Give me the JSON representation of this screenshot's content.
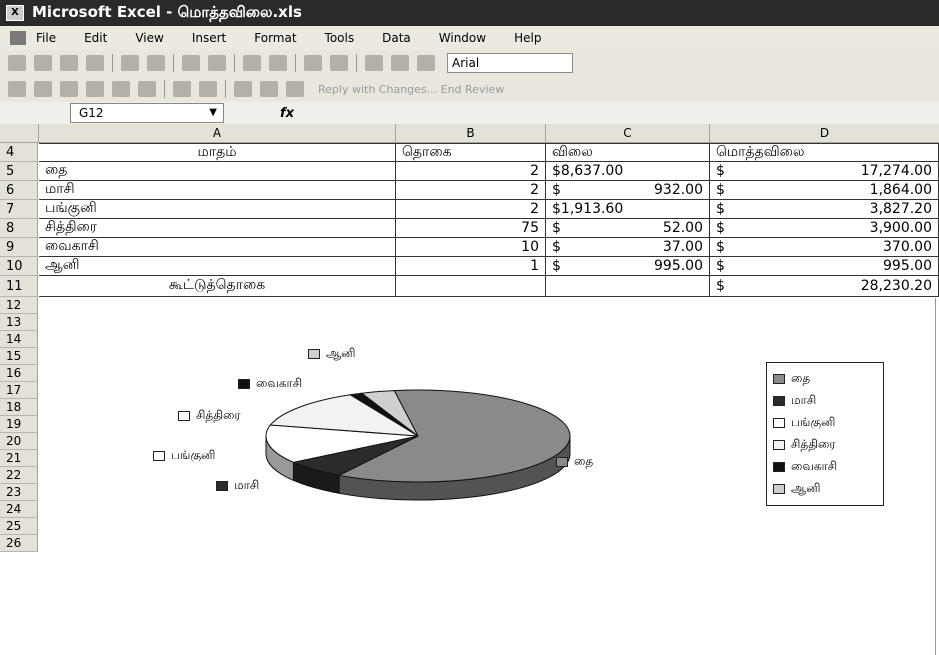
{
  "window": {
    "title": "Microsoft Excel - மொத்தவிலை.xls"
  },
  "menu": [
    "File",
    "Edit",
    "View",
    "Insert",
    "Format",
    "Tools",
    "Data",
    "Window",
    "Help"
  ],
  "toolbar": {
    "font_name": "Arial",
    "review_text": "Reply with Changes...  End Review"
  },
  "formula_bar": {
    "name_box": "G12",
    "fx": "fx"
  },
  "columns": [
    "A",
    "B",
    "C",
    "D"
  ],
  "rows": [
    {
      "num": "4",
      "a": "மாதம்",
      "b": "தொகை",
      "c": "விலை",
      "d": "மொத்தவிலை"
    },
    {
      "num": "5",
      "a": "தை",
      "b": "2",
      "c_cur": "$8,637.00",
      "d_cur": "$",
      "d_val": "17,274.00"
    },
    {
      "num": "6",
      "a": "மாசி",
      "b": "2",
      "c_cur": "$",
      "c_val": "932.00",
      "d_cur": "$",
      "d_val": "1,864.00"
    },
    {
      "num": "7",
      "a": "பங்குனி",
      "b": "2",
      "c_cur": "$1,913.60",
      "d_cur": "$",
      "d_val": "3,827.20"
    },
    {
      "num": "8",
      "a": "சித்திரை",
      "b": "75",
      "c_cur": "$",
      "c_val": "52.00",
      "d_cur": "$",
      "d_val": "3,900.00"
    },
    {
      "num": "9",
      "a": "வைகாசி",
      "b": "10",
      "c_cur": "$",
      "c_val": "37.00",
      "d_cur": "$",
      "d_val": "370.00"
    },
    {
      "num": "10",
      "a": "ஆனி",
      "b": "1",
      "c_cur": "$",
      "c_val": "995.00",
      "d_cur": "$",
      "d_val": "995.00"
    },
    {
      "num": "11",
      "a": "கூட்டுத்தொகை",
      "b": "",
      "c": "",
      "d_cur": "$",
      "d_val": "28,230.20"
    }
  ],
  "empty_rows": [
    "12",
    "13",
    "14",
    "15",
    "16",
    "17",
    "18",
    "19",
    "20",
    "21",
    "22",
    "23",
    "24",
    "25",
    "26"
  ],
  "chart_data": {
    "type": "pie",
    "categories": [
      "தை",
      "மாசி",
      "பங்குனி",
      "சித்திரை",
      "வைகாசி",
      "ஆனி"
    ],
    "values": [
      17274.0,
      1864.0,
      3827.2,
      3900.0,
      370.0,
      995.0
    ],
    "legend_position": "right",
    "colors": [
      "#8a8a8a",
      "#2b2b2b",
      "#ffffff",
      "#f2f2f2",
      "#111111",
      "#cfcfcf"
    ]
  }
}
